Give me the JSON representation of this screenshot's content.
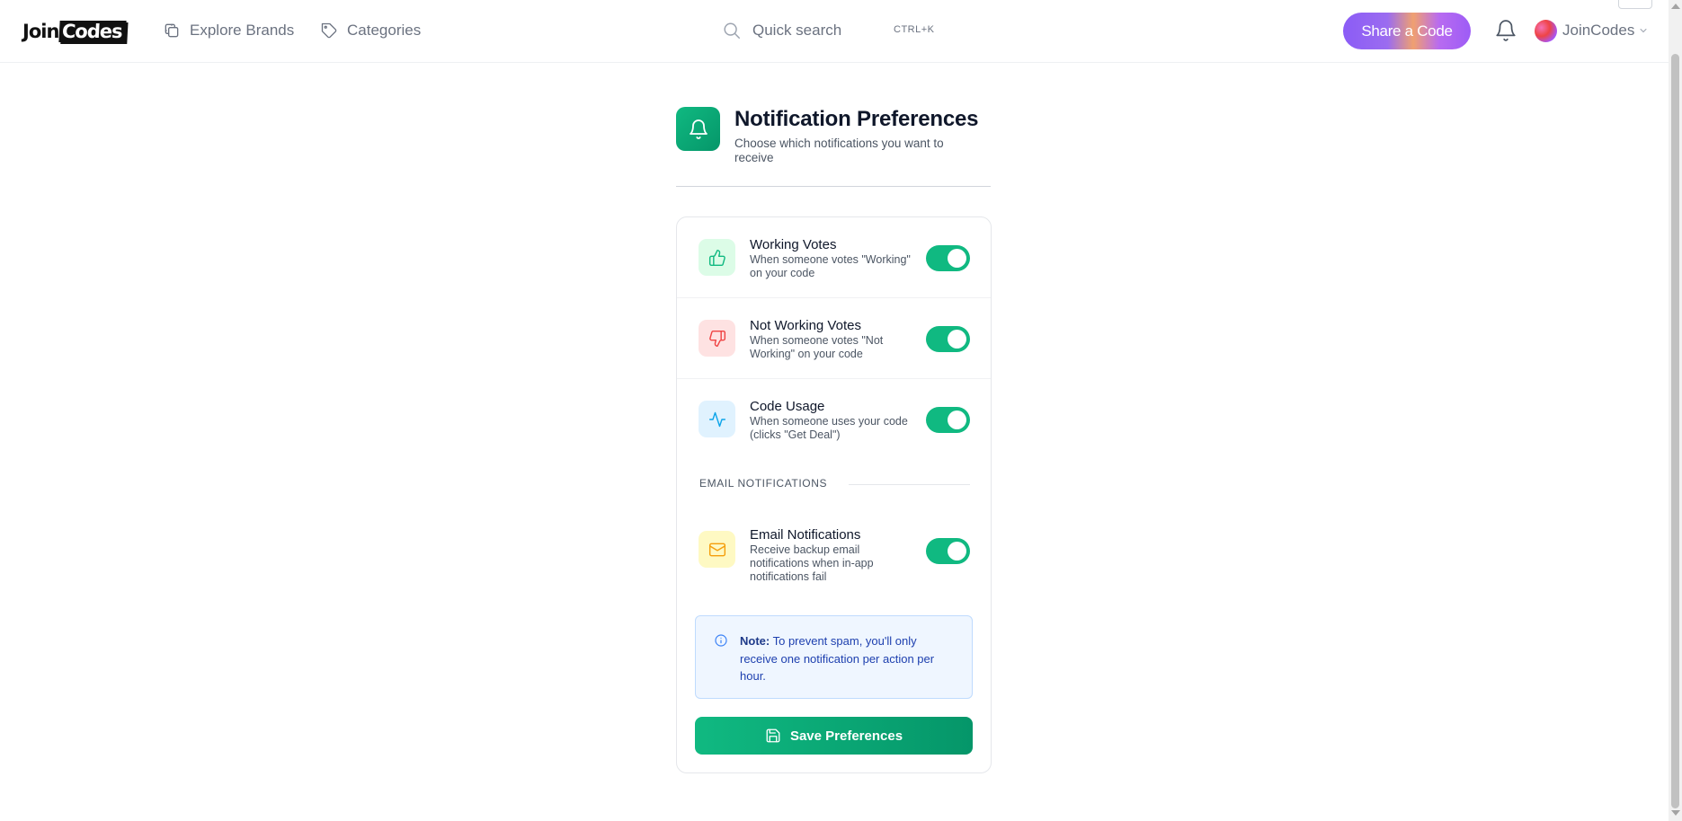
{
  "header": {
    "logo_left": "Join",
    "logo_right": "Codes",
    "nav": [
      {
        "label": "Explore Brands",
        "icon": "layers-icon"
      },
      {
        "label": "Categories",
        "icon": "tag-icon"
      }
    ],
    "search": {
      "placeholder": "Quick search",
      "shortcut": "CTRL+K"
    },
    "share_label": "Share a Code",
    "user_name": "JoinCodes"
  },
  "page": {
    "title": "Notification Preferences",
    "subtitle": "Choose which notifications you want to receive"
  },
  "preferences": [
    {
      "title": "Working Votes",
      "desc": "When someone votes \"Working\" on your code",
      "icon": "thumbs-up-icon",
      "enabled": true,
      "icon_bg": "#dcfce7",
      "icon_color": "#10b981"
    },
    {
      "title": "Not Working Votes",
      "desc": "When someone votes \"Not Working\" on your code",
      "icon": "thumbs-down-icon",
      "enabled": true,
      "icon_bg": "#fee2e2",
      "icon_color": "#ef4444"
    },
    {
      "title": "Code Usage",
      "desc": "When someone uses your code (clicks \"Get Deal\")",
      "icon": "activity-icon",
      "enabled": true,
      "icon_bg": "#e0f2fe",
      "icon_color": "#0ea5e9"
    }
  ],
  "email_section": {
    "label": "EMAIL NOTIFICATIONS",
    "item": {
      "title": "Email Notifications",
      "desc": "Receive backup email notifications when in-app notifications fail",
      "icon": "mail-icon",
      "enabled": true,
      "icon_bg": "#fef9c3",
      "icon_color": "#f59e0b"
    }
  },
  "note": {
    "label": "Note:",
    "text": " To prevent spam, you'll only receive one notification per action per hour."
  },
  "save_label": "Save Preferences",
  "colors": {
    "accent": "#10b981",
    "share_button": "#8b5cf6",
    "note_text": "#1e40af"
  }
}
